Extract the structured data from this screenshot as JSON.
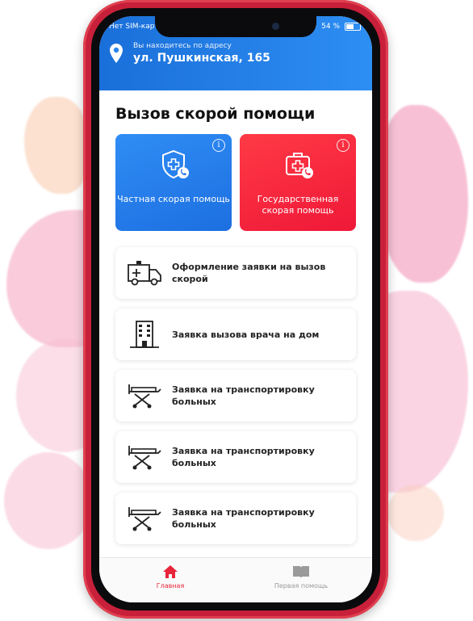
{
  "status_bar": {
    "carrier": "Нет SIM-карты",
    "battery": "54 %"
  },
  "location": {
    "caption": "Вы находитесь по адресу",
    "street": "ул. Пушкинская, 165"
  },
  "page_title": "Вызов скорой помощи",
  "cards": [
    {
      "label": "Частная скорая помощь",
      "icon": "shield-medical-phone-icon",
      "color": "#1f73e6"
    },
    {
      "label": "Государственная скорая помощь",
      "icon": "medkit-phone-icon",
      "color": "#f0203c"
    }
  ],
  "info_glyph": "i",
  "list": [
    {
      "label": "Оформление заявки на вызов скорой",
      "icon": "ambulance-icon"
    },
    {
      "label": "Заявка вызова врача на дом",
      "icon": "building-icon"
    },
    {
      "label": "Заявка на транспортировку больных",
      "icon": "stretcher-icon"
    },
    {
      "label": "Заявка на транспортировку больных",
      "icon": "stretcher-icon"
    },
    {
      "label": "Заявка на транспортировку больных",
      "icon": "stretcher-icon"
    }
  ],
  "tabs": [
    {
      "label": "Главная",
      "icon": "home-icon",
      "active": true
    },
    {
      "label": "Первая помощь",
      "icon": "book-icon",
      "active": false
    }
  ],
  "colors": {
    "accent_blue": "#1f73e6",
    "accent_red": "#e8243a",
    "phone_frame": "#c8203a"
  }
}
